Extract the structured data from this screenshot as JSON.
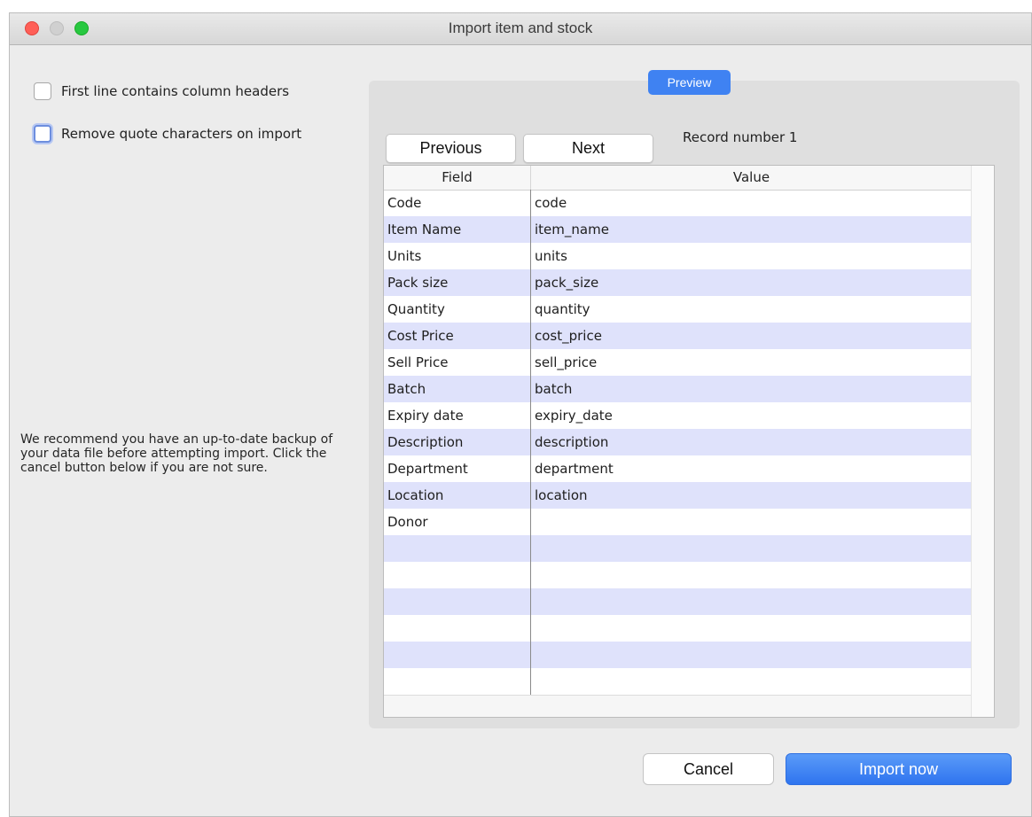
{
  "window": {
    "title": "Import item and stock"
  },
  "options": {
    "first_line_headers": {
      "label": "First line contains column headers",
      "checked": false
    },
    "remove_quotes": {
      "label": "Remove quote characters on import",
      "checked": false
    }
  },
  "note": "We recommend you have an up-to-date backup of your data file before attempting import. Click the cancel button below if you are not sure.",
  "preview": {
    "tab_label": "Preview",
    "previous_label": "Previous",
    "next_label": "Next",
    "record_text": "Record number 1",
    "columns": {
      "field": "Field",
      "value": "Value"
    },
    "rows": [
      {
        "field": "Code",
        "value": "code"
      },
      {
        "field": "Item Name",
        "value": "item_name"
      },
      {
        "field": "Units",
        "value": "units"
      },
      {
        "field": "Pack size",
        "value": "pack_size"
      },
      {
        "field": "Quantity",
        "value": "quantity"
      },
      {
        "field": "Cost Price",
        "value": "cost_price"
      },
      {
        "field": "Sell Price",
        "value": "sell_price"
      },
      {
        "field": "Batch",
        "value": "batch"
      },
      {
        "field": "Expiry date",
        "value": "expiry_date"
      },
      {
        "field": "Description",
        "value": "description"
      },
      {
        "field": "Department",
        "value": "department"
      },
      {
        "field": "Location",
        "value": "location"
      },
      {
        "field": "Donor",
        "value": ""
      },
      {
        "field": "",
        "value": ""
      },
      {
        "field": "",
        "value": ""
      },
      {
        "field": "",
        "value": ""
      },
      {
        "field": "",
        "value": ""
      },
      {
        "field": "",
        "value": ""
      },
      {
        "field": "",
        "value": ""
      }
    ]
  },
  "actions": {
    "cancel_label": "Cancel",
    "import_label": "Import now"
  }
}
